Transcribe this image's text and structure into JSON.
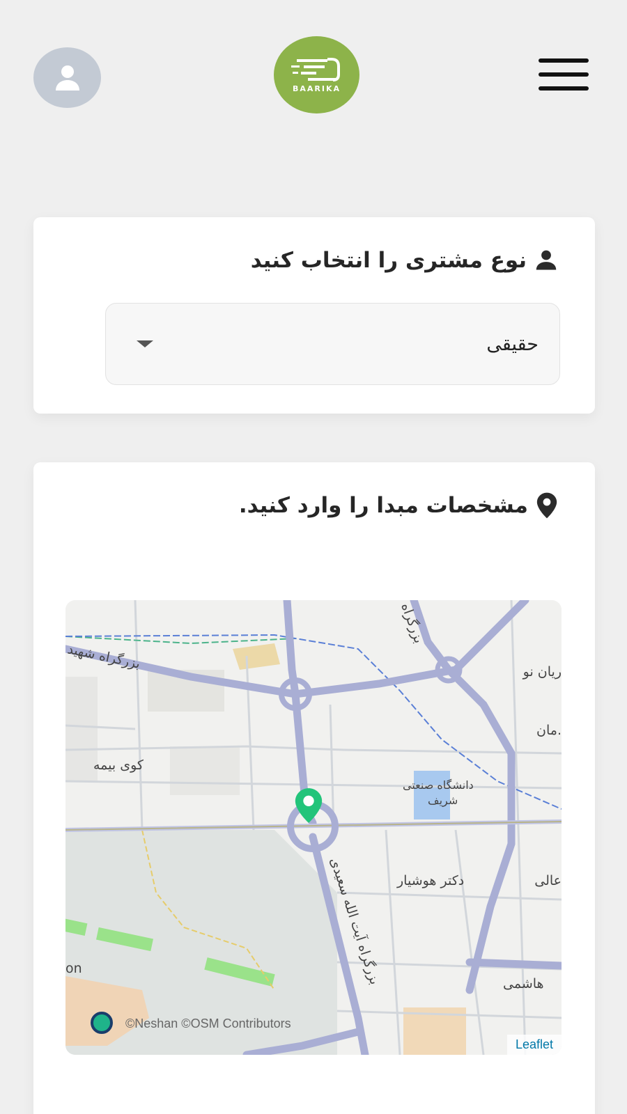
{
  "header": {
    "logo_text": "BAARIKA",
    "avatar_icon": "user-icon",
    "menu_icon": "hamburger-menu-icon"
  },
  "customer_type": {
    "title": "نوع مشتری را انتخاب کنید",
    "icon": "user-icon",
    "select_value": "حقیقی"
  },
  "origin": {
    "title": "مشخصات مبدا را وارد کنید.",
    "icon": "location-pin-icon"
  },
  "map": {
    "labels": {
      "highway_shahid": "بزرگراه شهید",
      "highway_top": "بزرگراه",
      "airyan": "ریان نو",
      "saman": ".مان",
      "kuye_bimeh": "کوی بیمه",
      "sharif_1": "دانشگاه صنعتی",
      "sharif_2": "شریف",
      "hooshyar": "دکتر هوشیار",
      "ali": "عالی",
      "saeedi": "بزرگراه آیت الله سعیدی",
      "hashemi": "هاشمی",
      "on": "on"
    },
    "attribution": "©Neshan ©OSM Contributors",
    "leaflet": "Leaflet",
    "marker_color": "#22c47a"
  },
  "colors": {
    "logo_green": "#8db34a",
    "avatar_gray": "#c3cad4",
    "road_purple": "#a9aed4"
  }
}
